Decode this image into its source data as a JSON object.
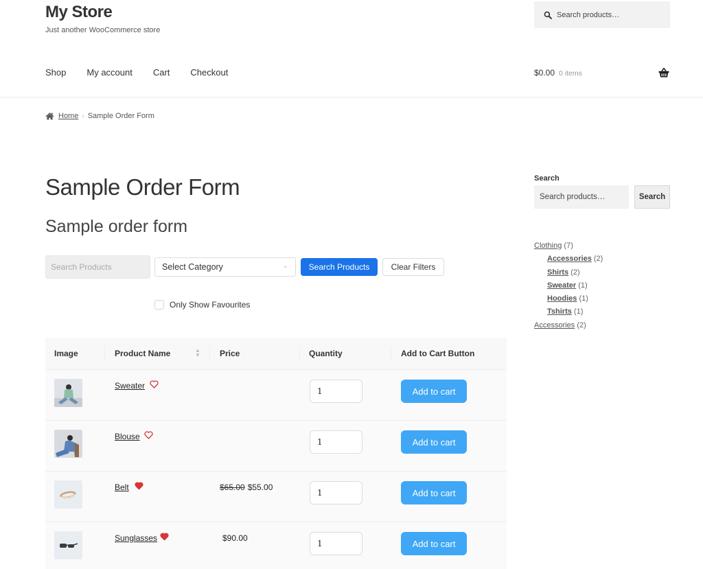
{
  "header": {
    "site_title": "My Store",
    "site_description": "Just another WooCommerce store",
    "search_placeholder": "Search products…",
    "nav": [
      {
        "label": "Shop"
      },
      {
        "label": "My account"
      },
      {
        "label": "Cart"
      },
      {
        "label": "Checkout"
      }
    ],
    "cart_total": "$0.00",
    "cart_count": "0 items",
    "icons": {
      "search": "search-icon",
      "cart": "basket-icon",
      "home": "home-icon"
    }
  },
  "breadcrumb": {
    "home": "Home",
    "separator": "›",
    "current": "Sample Order Form"
  },
  "main": {
    "page_title": "Sample Order Form",
    "form_title": "Sample order form",
    "filters": {
      "search_placeholder": "Search Products",
      "category_selected": "Select Category",
      "search_button": "Search Products",
      "clear_button": "Clear Filters",
      "favourites_label": "Only Show Favourites",
      "favourites_checked": false,
      "search_button_color": "#1a73e8"
    },
    "table": {
      "columns": [
        "Image",
        "Product Name",
        "Price",
        "Quantity",
        "Add to Cart Button"
      ],
      "rows": [
        {
          "name": "Sweater",
          "favourite": false,
          "price_regular": "",
          "price": "",
          "quantity": "1",
          "button": "Add to cart"
        },
        {
          "name": "Blouse",
          "favourite": false,
          "price_regular": "",
          "price": "",
          "quantity": "1",
          "button": "Add to cart"
        },
        {
          "name": "Belt",
          "favourite": true,
          "price_regular": "$65.00",
          "price": "$55.00",
          "quantity": "1",
          "button": "Add to cart"
        },
        {
          "name": "Sunglasses",
          "favourite": true,
          "price_regular": "",
          "price": "$90.00",
          "quantity": "1",
          "button": "Add to cart"
        }
      ],
      "button_color": "#3fa7f5",
      "heart_color": "#d63638"
    }
  },
  "sidebar": {
    "search_title": "Search",
    "search_placeholder": "Search products…",
    "search_button": "Search",
    "categories": [
      {
        "label": "Clothing",
        "count": "(7)",
        "level": 0
      },
      {
        "label": "Accessories",
        "count": "(2)",
        "level": 1
      },
      {
        "label": "Shirts",
        "count": "(2)",
        "level": 1
      },
      {
        "label": "Sweater",
        "count": "(1)",
        "level": 1
      },
      {
        "label": "Hoodies",
        "count": "(1)",
        "level": 1
      },
      {
        "label": "Tshirts",
        "count": "(1)",
        "level": 1
      },
      {
        "label": "Accessories",
        "count": "(2)",
        "level": 0
      }
    ]
  }
}
